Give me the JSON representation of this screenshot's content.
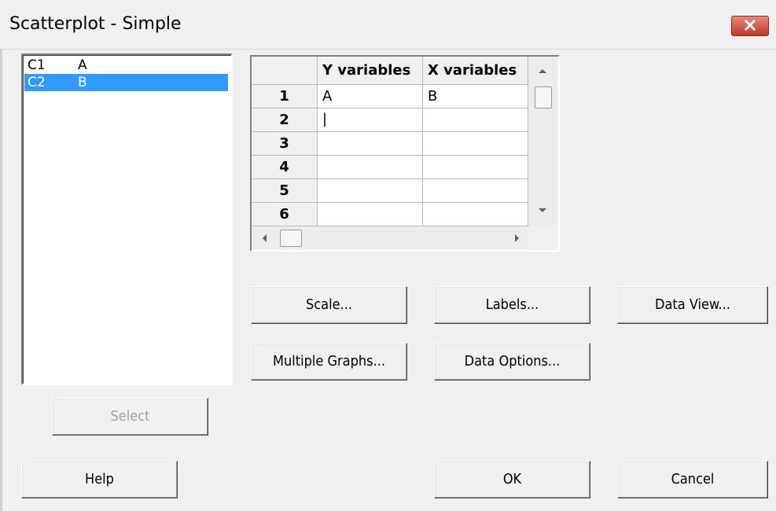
{
  "window": {
    "title": "Scatterplot - Simple"
  },
  "variables": [
    {
      "column": "C1",
      "name": "A",
      "selected": false
    },
    {
      "column": "C2",
      "name": "B",
      "selected": true
    }
  ],
  "grid": {
    "headers": [
      "Y variables",
      "X variables"
    ],
    "rows": [
      {
        "num": "1",
        "y": "A",
        "x": "B"
      },
      {
        "num": "2",
        "y": "|",
        "x": ""
      },
      {
        "num": "3",
        "y": "",
        "x": ""
      },
      {
        "num": "4",
        "y": "",
        "x": ""
      },
      {
        "num": "5",
        "y": "",
        "x": ""
      },
      {
        "num": "6",
        "y": "",
        "x": ""
      }
    ]
  },
  "buttons": {
    "scale": "Scale...",
    "labels": "Labels...",
    "data_view": "Data View...",
    "multiple_graphs": "Multiple Graphs...",
    "data_options": "Data Options...",
    "select": "Select",
    "help": "Help",
    "ok": "OK",
    "cancel": "Cancel"
  },
  "colors": {
    "selection": "#3399ff",
    "close_button": "#c0392b"
  }
}
